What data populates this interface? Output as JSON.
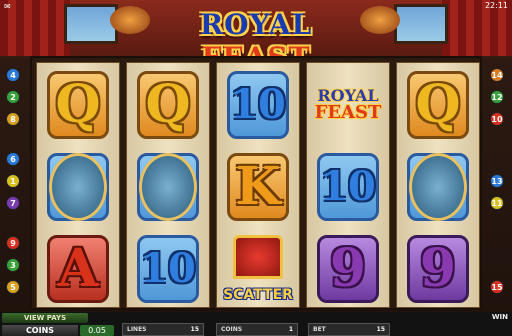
{
  "game": {
    "title_part1": "ROYAL",
    "title_part2": "FEAST",
    "clock": "22:11"
  },
  "reels": [
    [
      {
        "symbol": "Q",
        "kind": "letter",
        "style": "q",
        "frame": "orange"
      },
      {
        "symbol": "waiter",
        "kind": "character",
        "frame": "blue"
      },
      {
        "symbol": "A",
        "kind": "letter",
        "style": "a",
        "frame": "red"
      }
    ],
    [
      {
        "symbol": "Q",
        "kind": "letter",
        "style": "q",
        "frame": "orange"
      },
      {
        "symbol": "jester",
        "kind": "character",
        "frame": "blue"
      },
      {
        "symbol": "10",
        "kind": "letter",
        "style": "10",
        "frame": "blue"
      }
    ],
    [
      {
        "symbol": "10",
        "kind": "letter",
        "style": "10",
        "frame": "blue"
      },
      {
        "symbol": "K",
        "kind": "letter",
        "style": "k",
        "frame": "orange"
      },
      {
        "symbol": "scatter",
        "kind": "scatter",
        "label": "SCATTER"
      }
    ],
    [
      {
        "symbol": "royal-feast-logo",
        "kind": "wild",
        "l1": "ROYAL",
        "l2": "FEAST"
      },
      {
        "symbol": "10",
        "kind": "letter",
        "style": "10",
        "frame": "blue"
      },
      {
        "symbol": "9",
        "kind": "letter",
        "style": "9",
        "frame": "purple"
      }
    ],
    [
      {
        "symbol": "Q",
        "kind": "letter",
        "style": "q",
        "frame": "orange"
      },
      {
        "symbol": "king",
        "kind": "character",
        "frame": "blue"
      },
      {
        "symbol": "9",
        "kind": "letter",
        "style": "9",
        "frame": "purple"
      }
    ]
  ],
  "line_markers_left": [
    {
      "n": "4",
      "color": "#2a7ad8"
    },
    {
      "n": "2",
      "color": "#3aa03a"
    },
    {
      "n": "8",
      "color": "#d8a020"
    },
    {
      "n": "6",
      "color": "#2a7ad8"
    },
    {
      "n": "1",
      "color": "#d8c020"
    },
    {
      "n": "7",
      "color": "#7a3ab0"
    },
    {
      "n": "9",
      "color": "#d83020"
    },
    {
      "n": "3",
      "color": "#3aa03a"
    },
    {
      "n": "5",
      "color": "#d8a020"
    }
  ],
  "line_markers_right": [
    {
      "n": "14",
      "color": "#d87a20"
    },
    {
      "n": "12",
      "color": "#3aa03a"
    },
    {
      "n": "10",
      "color": "#d83020"
    },
    {
      "n": "13",
      "color": "#2a7ad8"
    },
    {
      "n": "11",
      "color": "#d8c020"
    },
    {
      "n": "15",
      "color": "#d83020"
    }
  ],
  "controls": {
    "view_pays": "VIEW PAYS",
    "coins_button": "COINS",
    "coin_value": "0.05",
    "lines_label": "LINES",
    "lines_value": "15",
    "coins_label": "COINS",
    "coins_value": "1",
    "bet_label": "BET",
    "bet_value": "15",
    "win_label": "WIN"
  }
}
